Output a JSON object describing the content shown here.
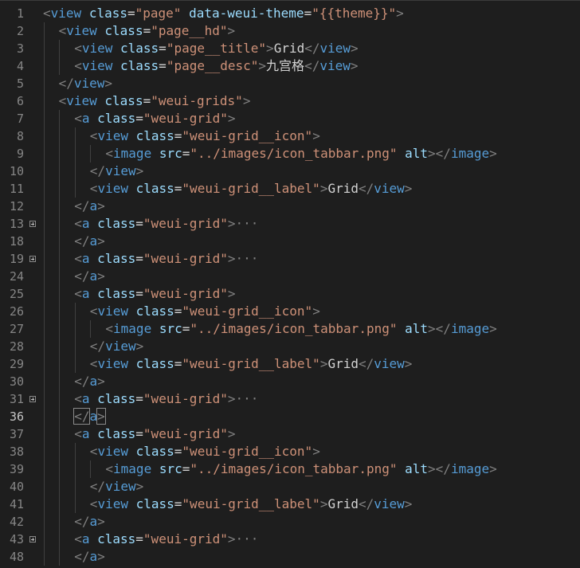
{
  "editor": {
    "theme_colors": {
      "background": "#1e1e1e",
      "punctuation": "#808080",
      "tag": "#569cd6",
      "attribute": "#9cdcfe",
      "string": "#ce9178",
      "text": "#d4d4d4",
      "line_number": "#858585"
    },
    "lines": [
      {
        "n": "1",
        "indent": 0,
        "fold": false,
        "tokens": [
          [
            "punct",
            "<"
          ],
          [
            "tag",
            "view"
          ],
          [
            "text",
            " "
          ],
          [
            "attr",
            "class"
          ],
          [
            "text",
            "="
          ],
          [
            "str",
            "\"page\""
          ],
          [
            "text",
            " "
          ],
          [
            "attr",
            "data-weui-theme"
          ],
          [
            "text",
            "="
          ],
          [
            "str",
            "\"{{theme}}\""
          ],
          [
            "punct",
            ">"
          ]
        ]
      },
      {
        "n": "2",
        "indent": 1,
        "fold": false,
        "tokens": [
          [
            "punct",
            "<"
          ],
          [
            "tag",
            "view"
          ],
          [
            "text",
            " "
          ],
          [
            "attr",
            "class"
          ],
          [
            "text",
            "="
          ],
          [
            "str",
            "\"page__hd\""
          ],
          [
            "punct",
            ">"
          ]
        ]
      },
      {
        "n": "3",
        "indent": 2,
        "fold": false,
        "tokens": [
          [
            "punct",
            "<"
          ],
          [
            "tag",
            "view"
          ],
          [
            "text",
            " "
          ],
          [
            "attr",
            "class"
          ],
          [
            "text",
            "="
          ],
          [
            "str",
            "\"page__title\""
          ],
          [
            "punct",
            ">"
          ],
          [
            "text",
            "Grid"
          ],
          [
            "punct",
            "</"
          ],
          [
            "tag",
            "view"
          ],
          [
            "punct",
            ">"
          ]
        ]
      },
      {
        "n": "4",
        "indent": 2,
        "fold": false,
        "tokens": [
          [
            "punct",
            "<"
          ],
          [
            "tag",
            "view"
          ],
          [
            "text",
            " "
          ],
          [
            "attr",
            "class"
          ],
          [
            "text",
            "="
          ],
          [
            "str",
            "\"page__desc\""
          ],
          [
            "punct",
            ">"
          ],
          [
            "text",
            "九宫格"
          ],
          [
            "punct",
            "</"
          ],
          [
            "tag",
            "view"
          ],
          [
            "punct",
            ">"
          ]
        ]
      },
      {
        "n": "5",
        "indent": 1,
        "fold": false,
        "tokens": [
          [
            "punct",
            "</"
          ],
          [
            "tag",
            "view"
          ],
          [
            "punct",
            ">"
          ]
        ]
      },
      {
        "n": "6",
        "indent": 1,
        "fold": false,
        "tokens": [
          [
            "punct",
            "<"
          ],
          [
            "tag",
            "view"
          ],
          [
            "text",
            " "
          ],
          [
            "attr",
            "class"
          ],
          [
            "text",
            "="
          ],
          [
            "str",
            "\"weui-grids\""
          ],
          [
            "punct",
            ">"
          ]
        ]
      },
      {
        "n": "7",
        "indent": 2,
        "fold": false,
        "tokens": [
          [
            "punct",
            "<"
          ],
          [
            "tag",
            "a"
          ],
          [
            "text",
            " "
          ],
          [
            "attr",
            "class"
          ],
          [
            "text",
            "="
          ],
          [
            "str",
            "\"weui-grid\""
          ],
          [
            "punct",
            ">"
          ]
        ]
      },
      {
        "n": "8",
        "indent": 3,
        "fold": false,
        "tokens": [
          [
            "punct",
            "<"
          ],
          [
            "tag",
            "view"
          ],
          [
            "text",
            " "
          ],
          [
            "attr",
            "class"
          ],
          [
            "text",
            "="
          ],
          [
            "str",
            "\"weui-grid__icon\""
          ],
          [
            "punct",
            ">"
          ]
        ]
      },
      {
        "n": "9",
        "indent": 4,
        "fold": false,
        "tokens": [
          [
            "punct",
            "<"
          ],
          [
            "tag",
            "image"
          ],
          [
            "text",
            " "
          ],
          [
            "attr",
            "src"
          ],
          [
            "text",
            "="
          ],
          [
            "str",
            "\"../images/icon_tabbar.png\""
          ],
          [
            "text",
            " "
          ],
          [
            "attr",
            "alt"
          ],
          [
            "punct",
            "></"
          ],
          [
            "tag",
            "image"
          ],
          [
            "punct",
            ">"
          ]
        ]
      },
      {
        "n": "10",
        "indent": 3,
        "fold": false,
        "tokens": [
          [
            "punct",
            "</"
          ],
          [
            "tag",
            "view"
          ],
          [
            "punct",
            ">"
          ]
        ]
      },
      {
        "n": "11",
        "indent": 3,
        "fold": false,
        "tokens": [
          [
            "punct",
            "<"
          ],
          [
            "tag",
            "view"
          ],
          [
            "text",
            " "
          ],
          [
            "attr",
            "class"
          ],
          [
            "text",
            "="
          ],
          [
            "str",
            "\"weui-grid__label\""
          ],
          [
            "punct",
            ">"
          ],
          [
            "text",
            "Grid"
          ],
          [
            "punct",
            "</"
          ],
          [
            "tag",
            "view"
          ],
          [
            "punct",
            ">"
          ]
        ]
      },
      {
        "n": "12",
        "indent": 2,
        "fold": false,
        "tokens": [
          [
            "punct",
            "</"
          ],
          [
            "tag",
            "a"
          ],
          [
            "punct",
            ">"
          ]
        ]
      },
      {
        "n": "13",
        "indent": 2,
        "fold": true,
        "tokens": [
          [
            "punct",
            "<"
          ],
          [
            "tag",
            "a"
          ],
          [
            "text",
            " "
          ],
          [
            "attr",
            "class"
          ],
          [
            "text",
            "="
          ],
          [
            "str",
            "\"weui-grid\""
          ],
          [
            "punct",
            ">"
          ],
          [
            "ell",
            "···"
          ]
        ]
      },
      {
        "n": "18",
        "indent": 2,
        "fold": false,
        "tokens": [
          [
            "punct",
            "</"
          ],
          [
            "tag",
            "a"
          ],
          [
            "punct",
            ">"
          ]
        ]
      },
      {
        "n": "19",
        "indent": 2,
        "fold": true,
        "tokens": [
          [
            "punct",
            "<"
          ],
          [
            "tag",
            "a"
          ],
          [
            "text",
            " "
          ],
          [
            "attr",
            "class"
          ],
          [
            "text",
            "="
          ],
          [
            "str",
            "\"weui-grid\""
          ],
          [
            "punct",
            ">"
          ],
          [
            "ell",
            "···"
          ]
        ]
      },
      {
        "n": "24",
        "indent": 2,
        "fold": false,
        "tokens": [
          [
            "punct",
            "</"
          ],
          [
            "tag",
            "a"
          ],
          [
            "punct",
            ">"
          ]
        ]
      },
      {
        "n": "25",
        "indent": 2,
        "fold": false,
        "tokens": [
          [
            "punct",
            "<"
          ],
          [
            "tag",
            "a"
          ],
          [
            "text",
            " "
          ],
          [
            "attr",
            "class"
          ],
          [
            "text",
            "="
          ],
          [
            "str",
            "\"weui-grid\""
          ],
          [
            "punct",
            ">"
          ]
        ]
      },
      {
        "n": "26",
        "indent": 3,
        "fold": false,
        "tokens": [
          [
            "punct",
            "<"
          ],
          [
            "tag",
            "view"
          ],
          [
            "text",
            " "
          ],
          [
            "attr",
            "class"
          ],
          [
            "text",
            "="
          ],
          [
            "str",
            "\"weui-grid__icon\""
          ],
          [
            "punct",
            ">"
          ]
        ]
      },
      {
        "n": "27",
        "indent": 4,
        "fold": false,
        "tokens": [
          [
            "punct",
            "<"
          ],
          [
            "tag",
            "image"
          ],
          [
            "text",
            " "
          ],
          [
            "attr",
            "src"
          ],
          [
            "text",
            "="
          ],
          [
            "str",
            "\"../images/icon_tabbar.png\""
          ],
          [
            "text",
            " "
          ],
          [
            "attr",
            "alt"
          ],
          [
            "punct",
            "></"
          ],
          [
            "tag",
            "image"
          ],
          [
            "punct",
            ">"
          ]
        ]
      },
      {
        "n": "28",
        "indent": 3,
        "fold": false,
        "tokens": [
          [
            "punct",
            "</"
          ],
          [
            "tag",
            "view"
          ],
          [
            "punct",
            ">"
          ]
        ]
      },
      {
        "n": "29",
        "indent": 3,
        "fold": false,
        "tokens": [
          [
            "punct",
            "<"
          ],
          [
            "tag",
            "view"
          ],
          [
            "text",
            " "
          ],
          [
            "attr",
            "class"
          ],
          [
            "text",
            "="
          ],
          [
            "str",
            "\"weui-grid__label\""
          ],
          [
            "punct",
            ">"
          ],
          [
            "text",
            "Grid"
          ],
          [
            "punct",
            "</"
          ],
          [
            "tag",
            "view"
          ],
          [
            "punct",
            ">"
          ]
        ]
      },
      {
        "n": "30",
        "indent": 2,
        "fold": false,
        "tokens": [
          [
            "punct",
            "</"
          ],
          [
            "tag",
            "a"
          ],
          [
            "punct",
            ">"
          ]
        ]
      },
      {
        "n": "31",
        "indent": 2,
        "fold": true,
        "tokens": [
          [
            "punct",
            "<"
          ],
          [
            "tag",
            "a"
          ],
          [
            "text",
            " "
          ],
          [
            "attr",
            "class"
          ],
          [
            "text",
            "="
          ],
          [
            "str",
            "\"weui-grid\""
          ],
          [
            "punct",
            ">"
          ],
          [
            "ell",
            "···"
          ]
        ]
      },
      {
        "n": "36",
        "indent": 2,
        "fold": false,
        "active": true,
        "tokens": [
          [
            "hl",
            "</"
          ],
          [
            "tag",
            "a"
          ],
          [
            "hl",
            ">"
          ]
        ]
      },
      {
        "n": "37",
        "indent": 2,
        "fold": false,
        "tokens": [
          [
            "punct",
            "<"
          ],
          [
            "tag",
            "a"
          ],
          [
            "text",
            " "
          ],
          [
            "attr",
            "class"
          ],
          [
            "text",
            "="
          ],
          [
            "str",
            "\"weui-grid\""
          ],
          [
            "punct",
            ">"
          ]
        ]
      },
      {
        "n": "38",
        "indent": 3,
        "fold": false,
        "tokens": [
          [
            "punct",
            "<"
          ],
          [
            "tag",
            "view"
          ],
          [
            "text",
            " "
          ],
          [
            "attr",
            "class"
          ],
          [
            "text",
            "="
          ],
          [
            "str",
            "\"weui-grid__icon\""
          ],
          [
            "punct",
            ">"
          ]
        ]
      },
      {
        "n": "39",
        "indent": 4,
        "fold": false,
        "tokens": [
          [
            "punct",
            "<"
          ],
          [
            "tag",
            "image"
          ],
          [
            "text",
            " "
          ],
          [
            "attr",
            "src"
          ],
          [
            "text",
            "="
          ],
          [
            "str",
            "\"../images/icon_tabbar.png\""
          ],
          [
            "text",
            " "
          ],
          [
            "attr",
            "alt"
          ],
          [
            "punct",
            "></"
          ],
          [
            "tag",
            "image"
          ],
          [
            "punct",
            ">"
          ]
        ]
      },
      {
        "n": "40",
        "indent": 3,
        "fold": false,
        "tokens": [
          [
            "punct",
            "</"
          ],
          [
            "tag",
            "view"
          ],
          [
            "punct",
            ">"
          ]
        ]
      },
      {
        "n": "41",
        "indent": 3,
        "fold": false,
        "tokens": [
          [
            "punct",
            "<"
          ],
          [
            "tag",
            "view"
          ],
          [
            "text",
            " "
          ],
          [
            "attr",
            "class"
          ],
          [
            "text",
            "="
          ],
          [
            "str",
            "\"weui-grid__label\""
          ],
          [
            "punct",
            ">"
          ],
          [
            "text",
            "Grid"
          ],
          [
            "punct",
            "</"
          ],
          [
            "tag",
            "view"
          ],
          [
            "punct",
            ">"
          ]
        ]
      },
      {
        "n": "42",
        "indent": 2,
        "fold": false,
        "tokens": [
          [
            "punct",
            "</"
          ],
          [
            "tag",
            "a"
          ],
          [
            "punct",
            ">"
          ]
        ]
      },
      {
        "n": "43",
        "indent": 2,
        "fold": true,
        "tokens": [
          [
            "punct",
            "<"
          ],
          [
            "tag",
            "a"
          ],
          [
            "text",
            " "
          ],
          [
            "attr",
            "class"
          ],
          [
            "text",
            "="
          ],
          [
            "str",
            "\"weui-grid\""
          ],
          [
            "punct",
            ">"
          ],
          [
            "ell",
            "···"
          ]
        ]
      },
      {
        "n": "48",
        "indent": 2,
        "fold": false,
        "tokens": [
          [
            "punct",
            "</"
          ],
          [
            "tag",
            "a"
          ],
          [
            "punct",
            ">"
          ]
        ]
      }
    ]
  }
}
